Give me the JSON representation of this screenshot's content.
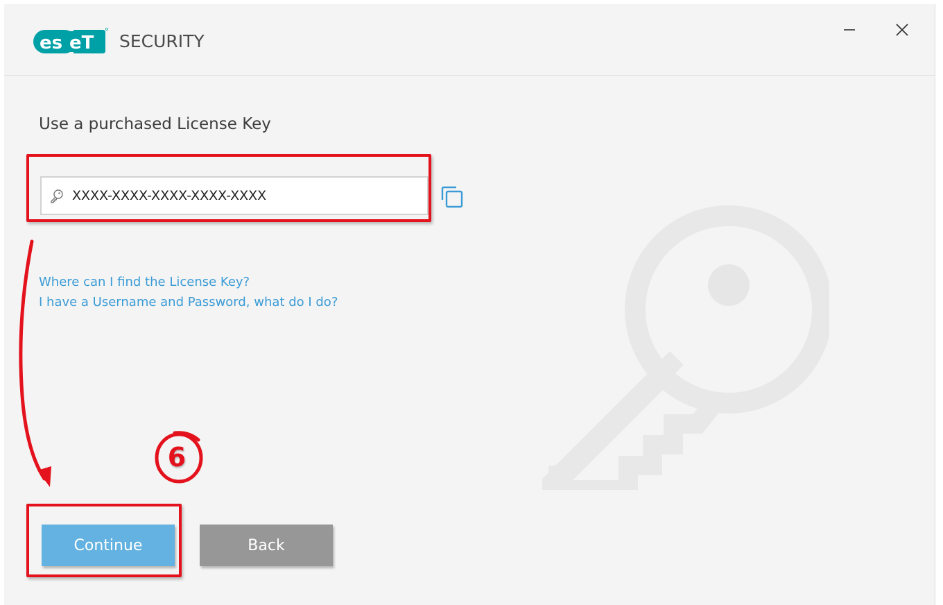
{
  "app": {
    "logo_text": "eset",
    "product_name": "SECURITY",
    "accent_color": "#00a1a6"
  },
  "window_controls": {
    "minimize_icon": "minimize-icon",
    "close_icon": "close-icon"
  },
  "page": {
    "heading": "Use a purchased License Key"
  },
  "license_field": {
    "value": "XXXX-XXXX-XXXX-XXXX-XXXX",
    "icon": "key-icon"
  },
  "paste_button": {
    "icon": "copy-paste-icon"
  },
  "links": {
    "find_key": "Where can I find the License Key?",
    "username_password": "I have a Username and Password, what do I do?"
  },
  "buttons": {
    "continue_label": "Continue",
    "back_label": "Back"
  },
  "annotation": {
    "step_number": "6",
    "color": "#e3121c"
  }
}
